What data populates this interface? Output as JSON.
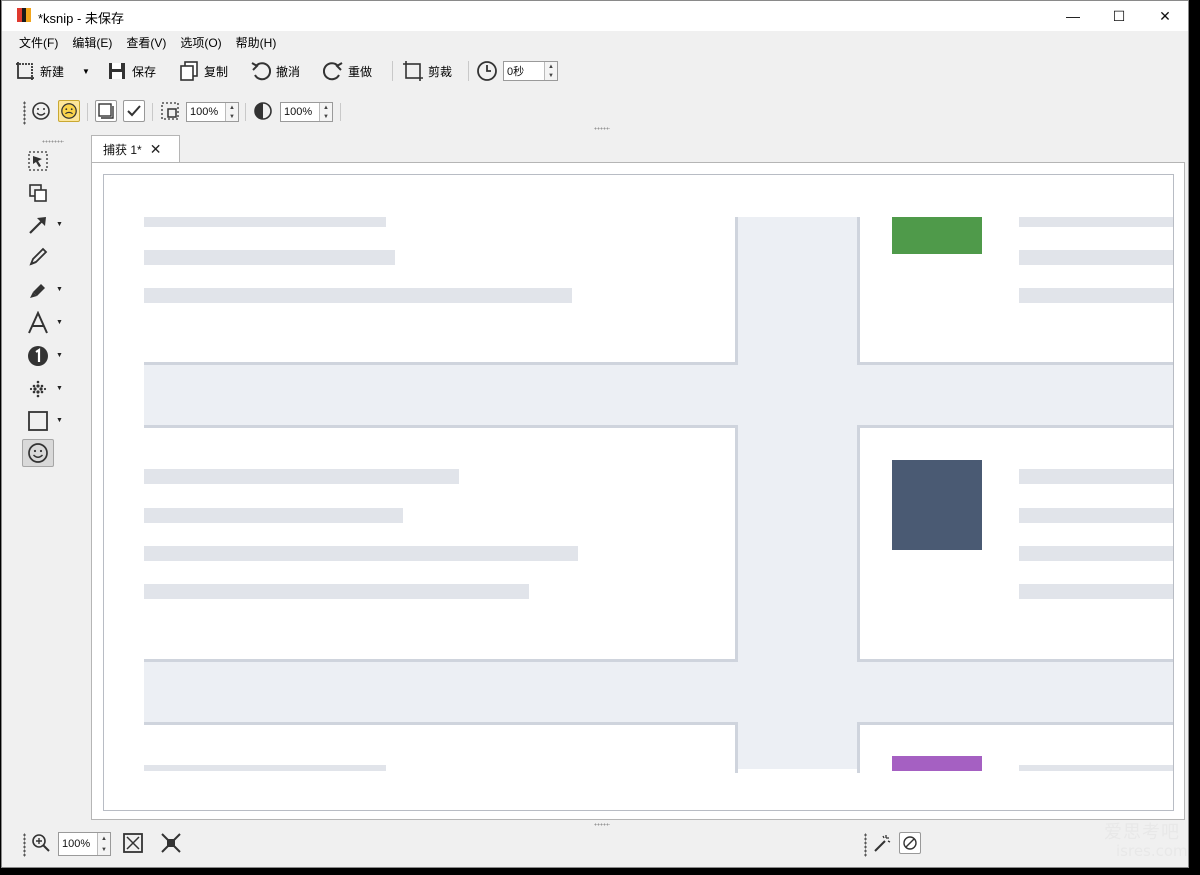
{
  "window": {
    "title": "*ksnip - 未保存",
    "controls": {
      "minimize": "—",
      "maximize": "☐",
      "close": "✕"
    }
  },
  "menu": [
    "文件(F)",
    "编辑(E)",
    "查看(V)",
    "选项(O)",
    "帮助(H)"
  ],
  "toolbar": {
    "new_label": "新建",
    "save_label": "保存",
    "copy_label": "复制",
    "undo_label": "撤消",
    "redo_label": "重做",
    "crop_label": "剪裁",
    "delay_value": "0秒"
  },
  "toolbar2": {
    "scale_value": "100%",
    "opacity_value": "100%"
  },
  "tools": [
    {
      "name": "select-tool"
    },
    {
      "name": "duplicate-tool"
    },
    {
      "name": "arrow-tool"
    },
    {
      "name": "pen-tool"
    },
    {
      "name": "marker-tool"
    },
    {
      "name": "text-tool"
    },
    {
      "name": "number-tool"
    },
    {
      "name": "blur-tool"
    },
    {
      "name": "rect-tool"
    },
    {
      "name": "sticker-tool"
    }
  ],
  "tab": {
    "label": "捕获 1*",
    "close": "✕"
  },
  "zoom": {
    "value": "100%"
  },
  "colors": {
    "green_block": "#4f9a4a",
    "slate_block": "#4a5a73",
    "purple_block": "#a560c2",
    "accent_active": "#fde69a"
  },
  "watermark": {
    "text": "爱思考吧",
    "site": "isres.com"
  }
}
